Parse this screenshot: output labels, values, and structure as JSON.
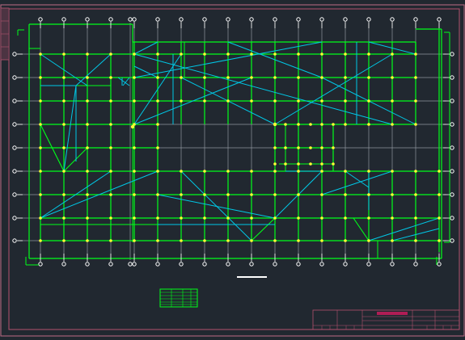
{
  "drawing": {
    "background": "#212830",
    "colors": {
      "frame": "#b3526e",
      "frame_light": "#c06b86",
      "axis_line": "#8f969e",
      "beam": "#00ff19",
      "brace": "#00c8e6",
      "node": "#ffff33",
      "bubble": "#ffffff",
      "title_accent": "#b01d55"
    },
    "layers": {
      "grid_axes": "axis-grid",
      "beams": "beam-lines",
      "braces": "diagonal-braces",
      "nodes": "column-nodes"
    },
    "icon": {
      "axis_bubble": "axis-bubble-circle",
      "title_block": "title-block-table",
      "legend": "legend-table"
    }
  }
}
